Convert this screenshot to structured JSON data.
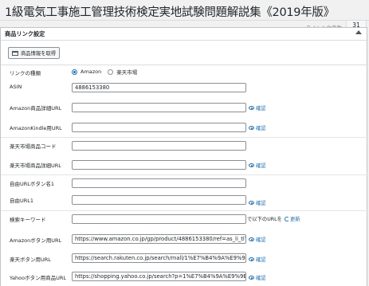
{
  "post": {
    "title": "1級電気工事施工管理技術検定実地試験問題解説集《2019年版》",
    "char_count_label": "タイトル文字数",
    "char_count": "31"
  },
  "metabox": {
    "title": "商品リンク設定",
    "fetch_button_label": "商品情報を取得"
  },
  "link_type": {
    "label": "リンクの種類",
    "options": [
      {
        "label": "Amazon",
        "selected": true
      },
      {
        "label": "楽天市場",
        "selected": false
      }
    ]
  },
  "fields": {
    "asin": {
      "label": "ASIN",
      "value": "4886153380"
    },
    "amazon_detail_url": {
      "label": "Amazon商品詳細URL",
      "value": "",
      "link": "確認"
    },
    "amazon_kindle_url": {
      "label": "AmazonKindle用URL",
      "value": "",
      "link": "確認"
    },
    "rakuten_code": {
      "label": "楽天市場商品コード",
      "value": ""
    },
    "rakuten_detail_url": {
      "label": "楽天市場商品詳細URL",
      "value": "",
      "link": "確認"
    },
    "free_url_button_1": {
      "label": "自由URLボタン名1",
      "value": ""
    },
    "free_url_1": {
      "label": "自由URL1",
      "value": "",
      "link": "確認"
    },
    "search_keyword": {
      "label": "検索キーワード",
      "value": "",
      "suffix": "で以下のURLを",
      "refresh": "更新"
    },
    "amazon_button_url": {
      "label": "Amazonボタン用URL",
      "value": "https://www.amazon.co.jp/gp/product/4886153380/ref=as_li_tl?ie",
      "link": "確認"
    },
    "rakuten_button_url": {
      "label": "楽天ボタン用URL",
      "value": "https://search.rakuten.co.jp/search/mall/1%E7%B4%9A%E9%9B%BB",
      "link": "確認"
    },
    "yahoo_button_url": {
      "label": "Yahooボタン用商品URL",
      "value": "https://shopping.yahoo.co.jp/search?p=1%E7%B4%9A%E9%9B%BB",
      "link": "確認"
    }
  }
}
